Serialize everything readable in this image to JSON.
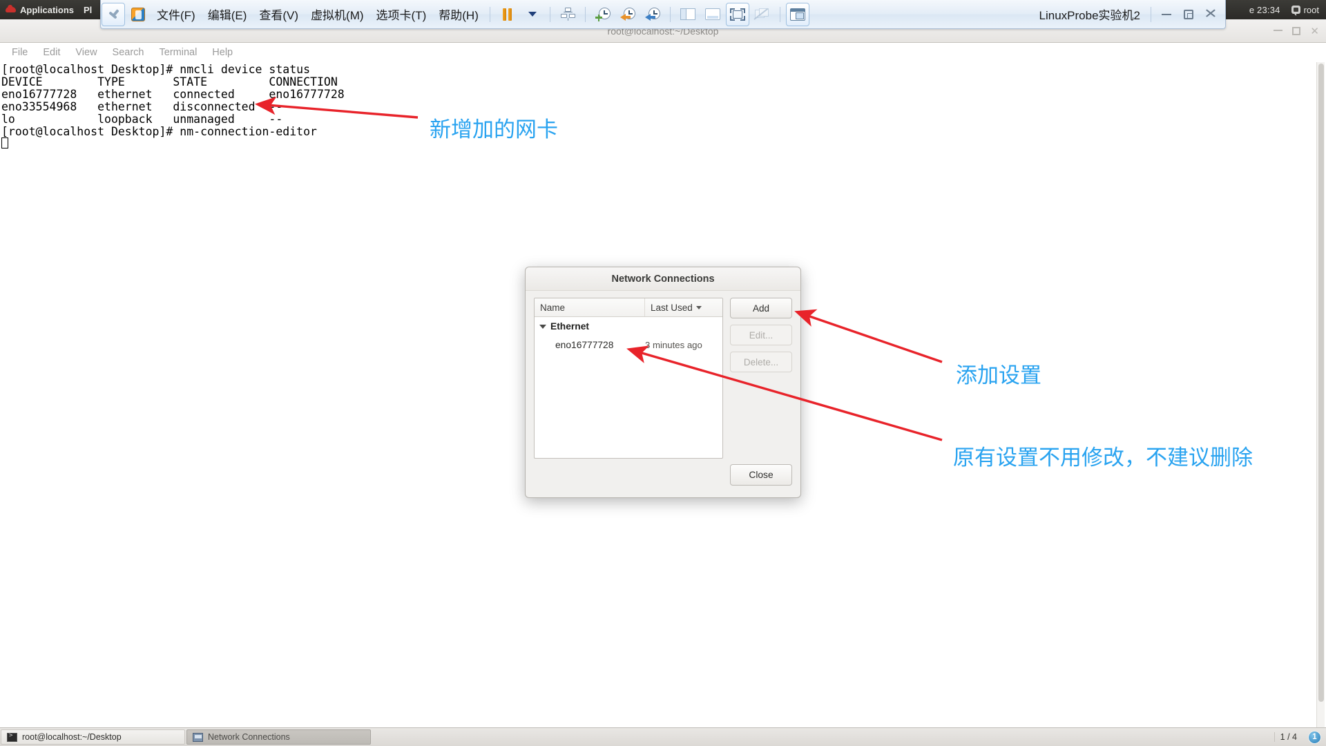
{
  "gnome_panel": {
    "applications_label": "Applications",
    "places_label": "Pl",
    "clock": "e 23:34",
    "user": "root"
  },
  "vmware_toolbar": {
    "menus": [
      {
        "label": "文件(F)",
        "name": "menu-file"
      },
      {
        "label": "编辑(E)",
        "name": "menu-edit"
      },
      {
        "label": "查看(V)",
        "name": "menu-view"
      },
      {
        "label": "虚拟机(M)",
        "name": "menu-vm"
      },
      {
        "label": "选项卡(T)",
        "name": "menu-tabs"
      },
      {
        "label": "帮助(H)",
        "name": "menu-help"
      }
    ],
    "vm_title": "LinuxProbe实验机2"
  },
  "terminal": {
    "window_title": "root@localhost:~/Desktop",
    "menubar": [
      "File",
      "Edit",
      "View",
      "Search",
      "Terminal",
      "Help"
    ],
    "output": "[root@localhost Desktop]# nmcli device status\nDEVICE        TYPE       STATE         CONNECTION\neno16777728   ethernet   connected     eno16777728\neno33554968   ethernet   disconnected  --\nlo            loopback   unmanaged     --\n[root@localhost Desktop]# nm-connection-editor\n"
  },
  "network_dialog": {
    "title": "Network Connections",
    "columns": {
      "name": "Name",
      "last_used": "Last Used"
    },
    "group": "Ethernet",
    "rows": [
      {
        "name": "eno16777728",
        "last_used": "3 minutes ago"
      }
    ],
    "buttons": {
      "add": "Add",
      "edit": "Edit...",
      "delete": "Delete...",
      "close": "Close"
    }
  },
  "annotations": {
    "accent_color": "#29a3f0",
    "arrow_color": "#e8232a",
    "items": [
      {
        "text": "新增加的网卡",
        "name": "annotation-new-nic"
      },
      {
        "text": "添加设置",
        "name": "annotation-add-settings"
      },
      {
        "text": "原有设置不用修改，不建议删除",
        "name": "annotation-keep-existing"
      }
    ]
  },
  "taskbar": {
    "tasks": [
      {
        "label": "root@localhost:~/Desktop",
        "name": "taskbar-task-terminal"
      },
      {
        "label": "Network Connections",
        "name": "taskbar-task-network"
      }
    ],
    "pager": "1 / 4",
    "workspace_badge": "1"
  }
}
